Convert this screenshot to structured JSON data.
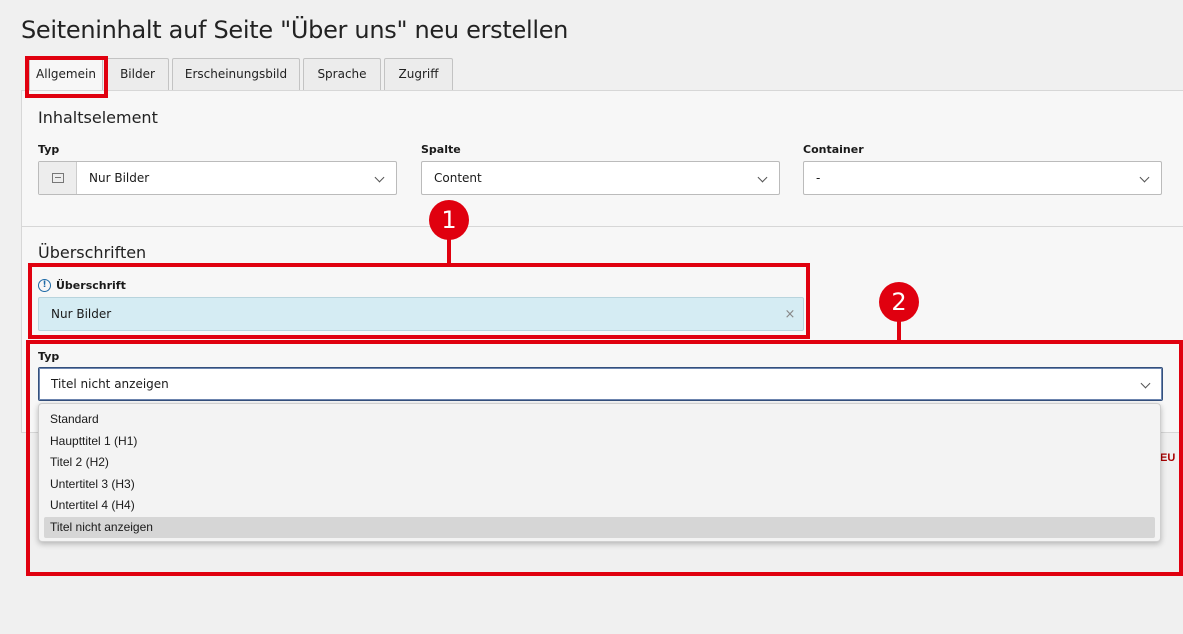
{
  "page": {
    "title": "Seiteninhalt auf Seite \"Über uns\" neu erstellen"
  },
  "tabs": [
    {
      "label": "Allgemein",
      "active": true
    },
    {
      "label": "Bilder"
    },
    {
      "label": "Erscheinungsbild"
    },
    {
      "label": "Sprache"
    },
    {
      "label": "Zugriff"
    }
  ],
  "inhaltselement": {
    "title": "Inhaltselement",
    "typ": {
      "label": "Typ",
      "value": "Nur Bilder",
      "icon": "image-icon"
    },
    "spalte": {
      "label": "Spalte",
      "value": "Content"
    },
    "container": {
      "label": "Container",
      "value": "-"
    }
  },
  "ueberschriften": {
    "title": "Überschriften",
    "ueberschrift": {
      "label": "Überschrift",
      "value": "Nur Bilder",
      "info_icon": "!"
    },
    "typ": {
      "label": "Typ",
      "value": "Titel nicht anzeigen",
      "options": [
        "Standard",
        "Haupttitel 1 (H1)",
        "Titel 2 (H2)",
        "Untertitel 3 (H3)",
        "Untertitel 4 (H4)",
        "Titel nicht anzeigen"
      ],
      "selected_index": 5
    }
  },
  "clipped_text": "EU",
  "annotations": {
    "marker1": "1",
    "marker2": "2",
    "color": "#e0000f"
  },
  "clear_symbol": "×"
}
